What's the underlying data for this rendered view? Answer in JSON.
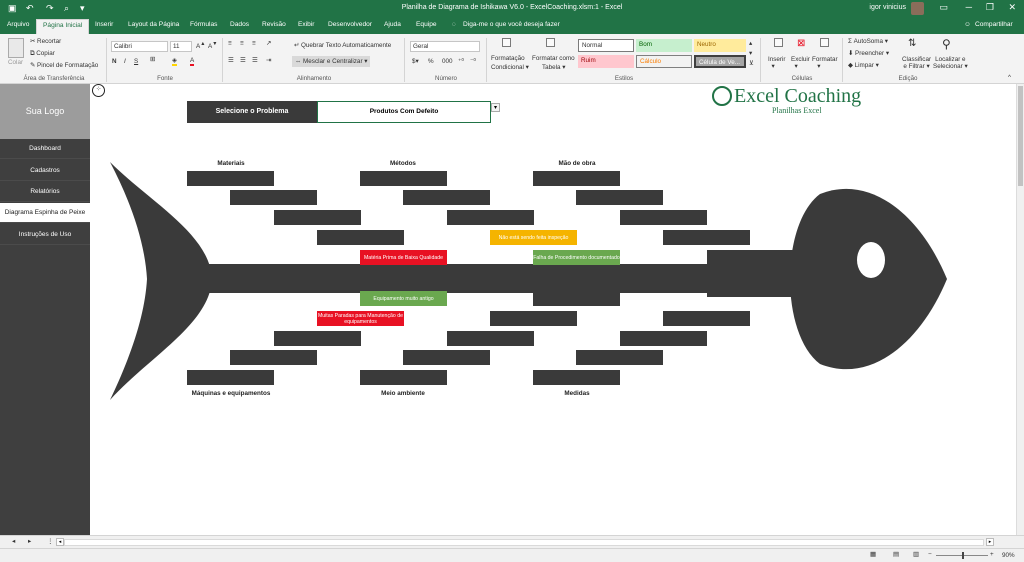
{
  "titlebar": {
    "title": "Planilha de Diagrama de Ishikawa V6.0 - ExcelCoaching.xlsm:1  -  Excel",
    "user": "igor vinicius"
  },
  "tabs": [
    "Arquivo",
    "Página Inicial",
    "Inserir",
    "Layout da Página",
    "Fórmulas",
    "Dados",
    "Revisão",
    "Exibir",
    "Desenvolvedor",
    "Ajuda",
    "Equipe"
  ],
  "tell_me": "Diga-me o que você deseja fazer",
  "share": "Compartilhar",
  "ribbon": {
    "clipboard": {
      "paste": "Colar",
      "cut": "Recortar",
      "copy": "Copiar",
      "painter": "Pincel de Formatação",
      "group": "Área de Transferência"
    },
    "font": {
      "name": "Calibri",
      "size": "11",
      "group": "Fonte"
    },
    "alignment": {
      "wrap": "Quebrar Texto Automaticamente",
      "merge": "Mesclar e Centralizar",
      "group": "Alinhamento"
    },
    "number": {
      "format": "Geral",
      "group": "Número"
    },
    "styles": {
      "cond1": "Formatação",
      "cond2": "Condicional",
      "table1": "Formatar como",
      "table2": "Tabela",
      "normal": "Normal",
      "bom": "Bom",
      "neutro": "Neutro",
      "ruim": "Ruim",
      "calculo": "Cálculo",
      "celula": "Célula de Ve...",
      "group": "Estilos"
    },
    "cells": {
      "insert": "Inserir",
      "delete": "Excluir",
      "format": "Formatar",
      "group": "Células"
    },
    "editing": {
      "autosum": "AutoSoma",
      "fill": "Preencher",
      "clear": "Limpar",
      "sort1": "Classificar",
      "sort2": "e Filtrar",
      "find1": "Localizar e",
      "find2": "Selecionar",
      "group": "Edição"
    }
  },
  "sidebar": {
    "logo": "Sua Logo",
    "items": [
      "Dashboard",
      "Cadastros",
      "Relatórios",
      "Diagrama Espinha de Peixe",
      "Instruções de Uso"
    ],
    "active": "Diagrama Espinha de Peixe"
  },
  "selector": {
    "label": "Selecione o Problema",
    "value": "Produtos Com Defeito"
  },
  "brand": {
    "name": "Excel Coaching",
    "tagline": "Planilhas Excel"
  },
  "categories": {
    "top": [
      "Materiais",
      "Métodos",
      "Mão de obra"
    ],
    "bottom": [
      "Máquinas e equipamentos",
      "Meio ambiente",
      "Medidas"
    ]
  },
  "causes": {
    "yellow": "Não está sendo feita inspeção",
    "red_top": "Matéria Prima de Baixa Qualidade",
    "green_top": "Falha de Procedimento documentado",
    "green_bottom": "Equipamento muito antigo",
    "red_bottom": "Muitas Paradas para Manutenção de equipamentos"
  },
  "colors": {
    "excel_green": "#217346",
    "yellow": "#f5b400",
    "red": "#e81123",
    "green": "#6aa84f",
    "dark": "#3a3a3a"
  },
  "statusbar": {
    "zoom": "90%"
  }
}
